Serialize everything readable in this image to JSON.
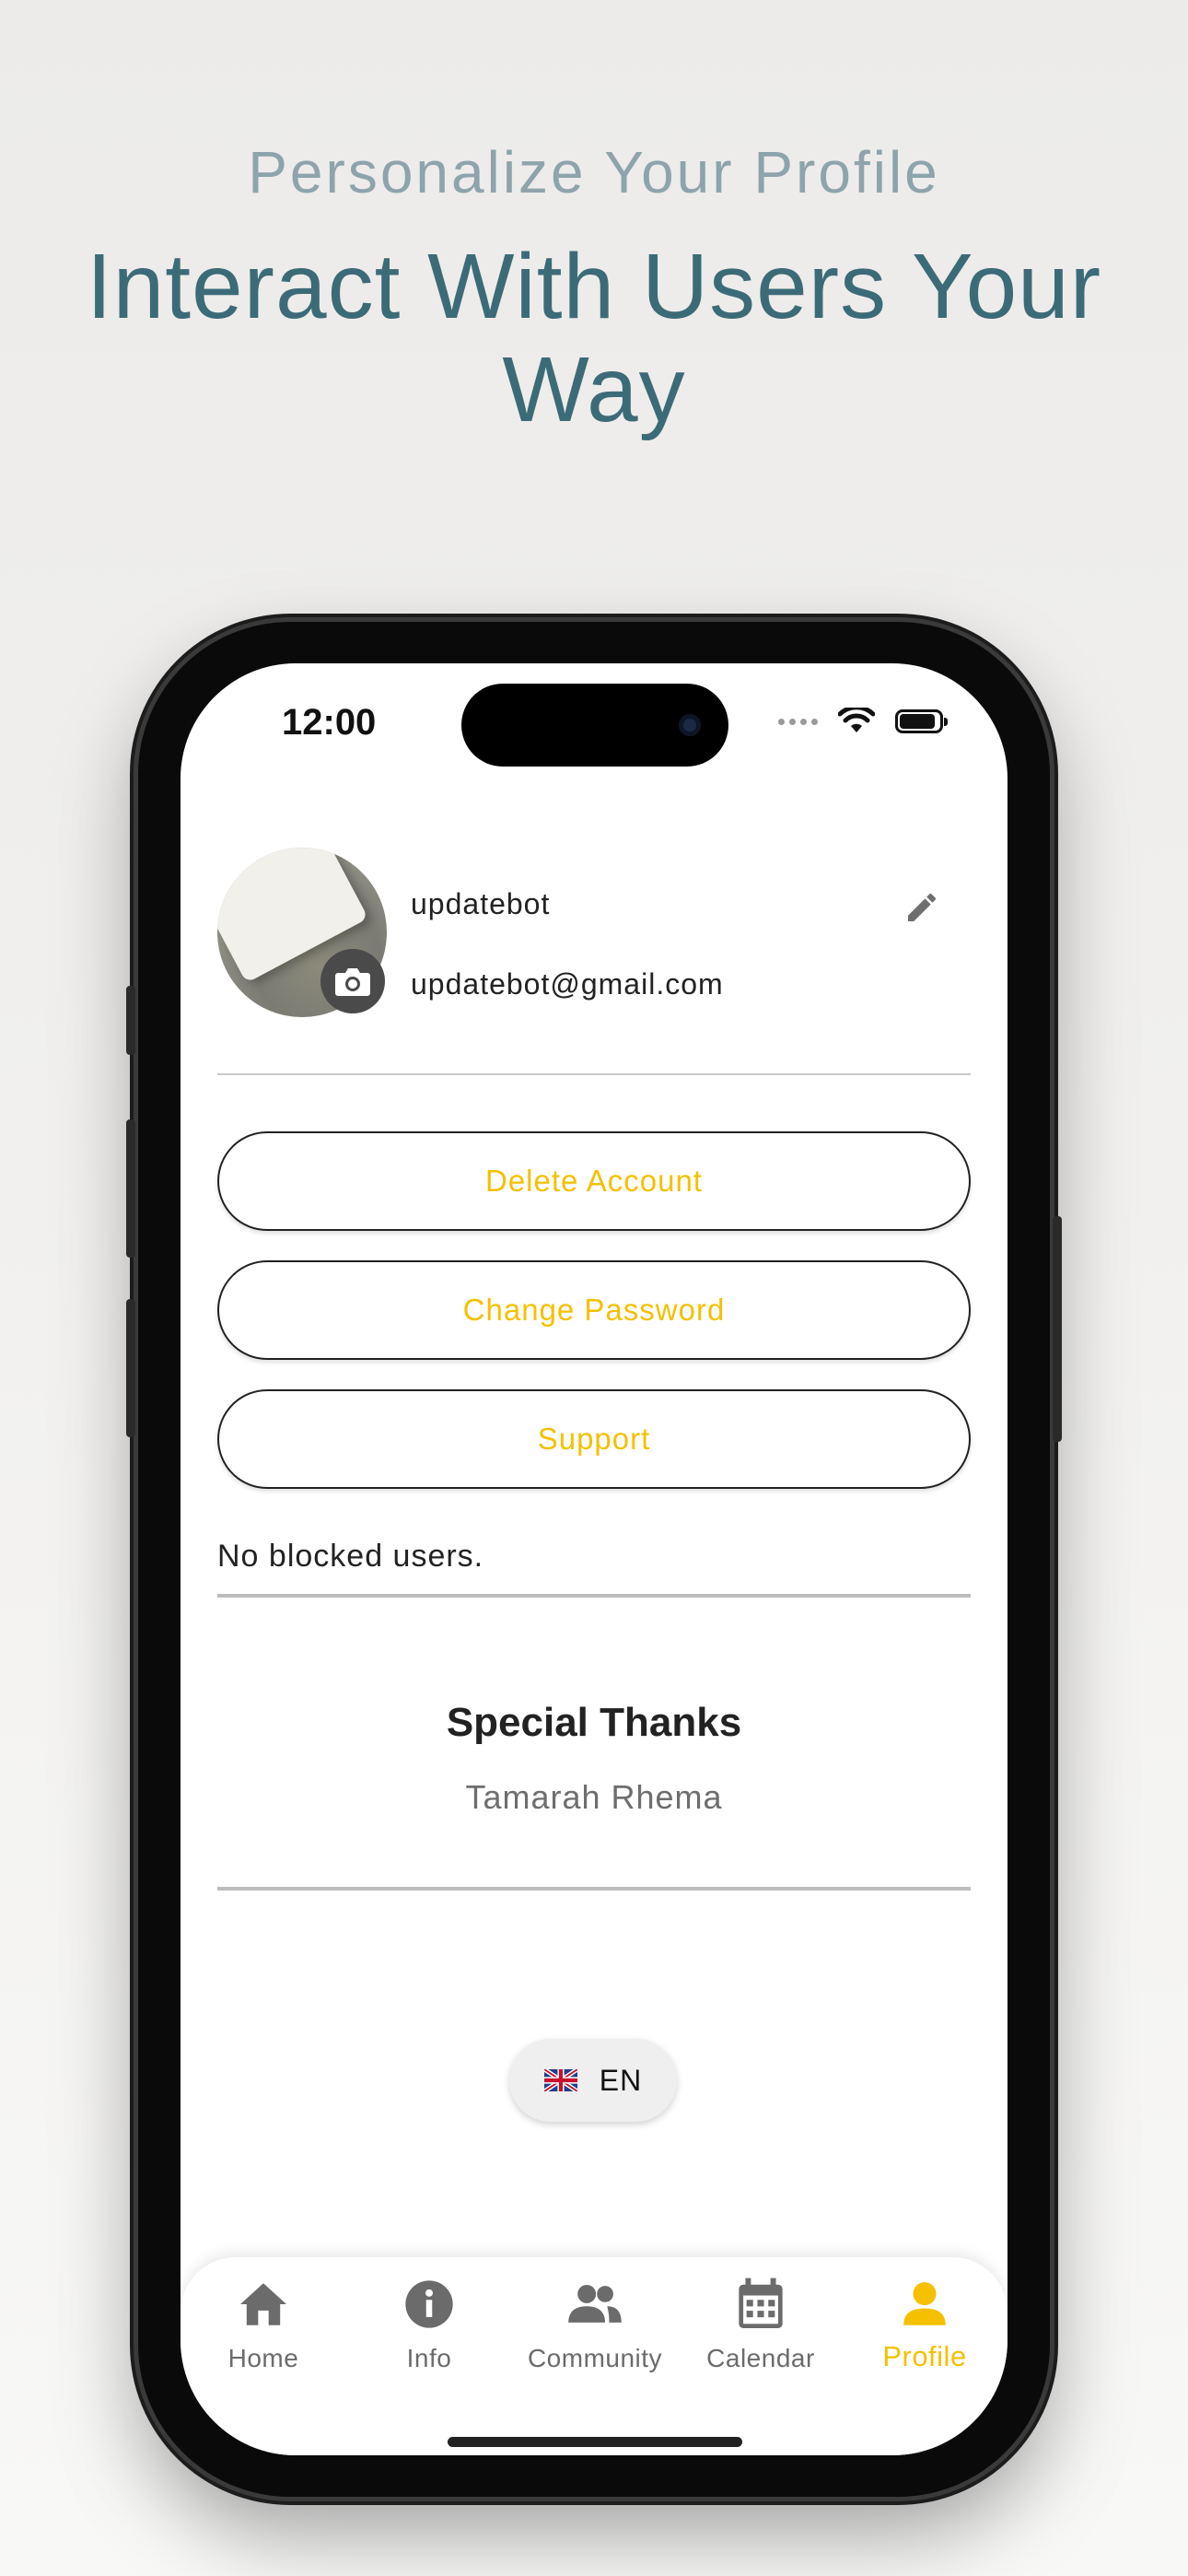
{
  "promo": {
    "subtitle": "Personalize Your Profile",
    "title": "Interact With Users Your Way"
  },
  "status_bar": {
    "time": "12:00"
  },
  "profile": {
    "username": "updatebot",
    "email": "updatebot@gmail.com"
  },
  "actions": {
    "delete_account": "Delete Account",
    "change_password": "Change Password",
    "support": "Support"
  },
  "blocked_users_text": "No blocked users.",
  "credits": {
    "title": "Special Thanks",
    "name": "Tamarah Rhema"
  },
  "language": {
    "selected": "EN",
    "flag_icon": "uk-flag-icon"
  },
  "tabbar": {
    "items": [
      {
        "label": "Home",
        "icon": "home-icon"
      },
      {
        "label": "Info",
        "icon": "info-icon"
      },
      {
        "label": "Community",
        "icon": "people-icon"
      },
      {
        "label": "Calendar",
        "icon": "calendar-icon"
      },
      {
        "label": "Profile",
        "icon": "person-icon",
        "active": true
      }
    ]
  },
  "colors": {
    "accent": "#f5c000",
    "promo_title": "#3c6b78",
    "promo_subtitle": "#8ea4ab"
  }
}
